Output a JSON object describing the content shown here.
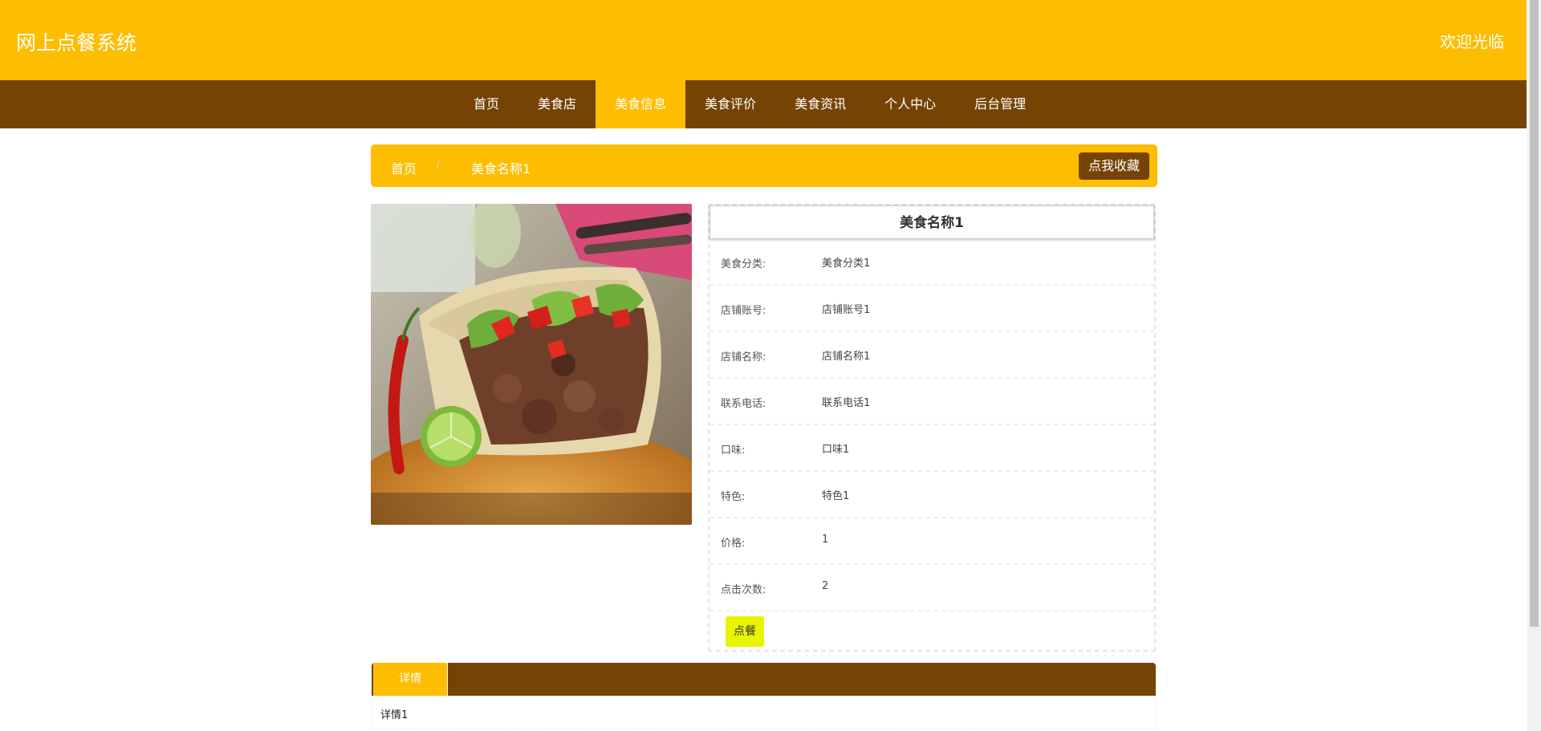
{
  "header": {
    "title": "网上点餐系统",
    "welcome": "欢迎光临"
  },
  "nav": {
    "items": [
      "首页",
      "美食店",
      "美食信息",
      "美食评价",
      "美食资讯",
      "个人中心",
      "后台管理"
    ],
    "active_index": 2
  },
  "breadcrumb": {
    "home": "首页",
    "separator": "/",
    "current": "美食名称1",
    "favorite_button": "点我收藏"
  },
  "detail": {
    "title": "美食名称1",
    "fields": [
      {
        "label": "美食分类:",
        "value": "美食分类1"
      },
      {
        "label": "店铺账号:",
        "value": "店铺账号1"
      },
      {
        "label": "店铺名称:",
        "value": "店铺名称1"
      },
      {
        "label": "联系电话:",
        "value": "联系电话1"
      },
      {
        "label": "口味:",
        "value": "口味1"
      },
      {
        "label": "特色:",
        "value": "特色1"
      },
      {
        "label": "价格:",
        "value": "1"
      },
      {
        "label": "点击次数:",
        "value": "2"
      }
    ],
    "order_button": "点餐"
  },
  "tabs": {
    "detail_tab": "详情",
    "detail_text": "详情1"
  },
  "colors": {
    "accent": "#fdbd00",
    "brown": "#754405",
    "order_button": "#e8f400"
  }
}
